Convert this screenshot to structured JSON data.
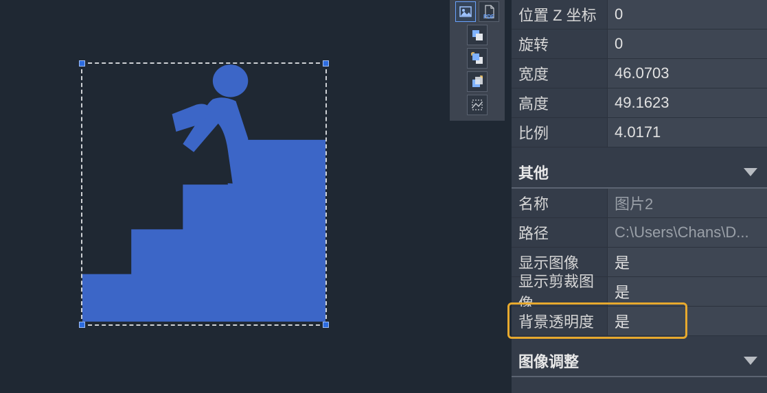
{
  "canvas": {
    "selected_image_name": "图片2"
  },
  "toolbar": {
    "pdf_label": "PDF"
  },
  "props": {
    "geometry_rows": [
      {
        "label": "位置 Z 坐标",
        "value": "0"
      },
      {
        "label": "旋转",
        "value": "0"
      },
      {
        "label": "宽度",
        "value": "46.0703"
      },
      {
        "label": "高度",
        "value": "49.1623"
      },
      {
        "label": "比例",
        "value": "4.0171"
      }
    ],
    "section_other": "其他",
    "other_rows": [
      {
        "label": "名称",
        "value": "图片2",
        "dim": true
      },
      {
        "label": "路径",
        "value": "C:\\Users\\Chans\\D...",
        "dim": true
      },
      {
        "label": "显示图像",
        "value": "是"
      },
      {
        "label": "显示剪裁图像",
        "value": "是"
      },
      {
        "label": "背景透明度",
        "value": "是"
      }
    ],
    "section_adjust": "图像调整"
  }
}
